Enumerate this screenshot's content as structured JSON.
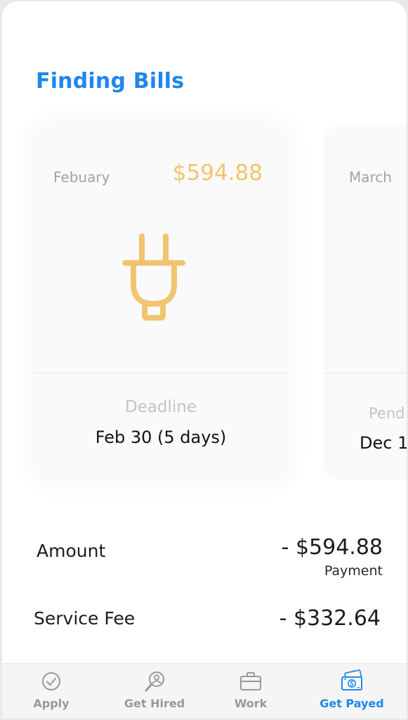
{
  "header": {
    "title": "Finding Bills"
  },
  "cards": [
    {
      "month": "Febuary",
      "amount": "$594.88",
      "icon": "plug-icon",
      "label": "Deadline",
      "value": "Feb 30 (5 days)"
    },
    {
      "month": "March",
      "label": "Pend",
      "value": "Dec 1"
    }
  ],
  "summary": {
    "amount_label": "Amount",
    "amount_value": "- $594.88",
    "amount_sub": "Payment",
    "fee_label": "Service Fee",
    "fee_value": "- $332.64"
  },
  "tabs": [
    {
      "label": "Apply",
      "icon": "check-circle-icon",
      "active": false
    },
    {
      "label": "Get Hired",
      "icon": "search-person-icon",
      "active": false
    },
    {
      "label": "Work",
      "icon": "briefcase-icon",
      "active": false
    },
    {
      "label": "Get Payed",
      "icon": "money-stack-icon",
      "active": true
    }
  ],
  "colors": {
    "accent": "#1f86ee",
    "amount": "#f1c46f",
    "inactive": "#999999"
  }
}
